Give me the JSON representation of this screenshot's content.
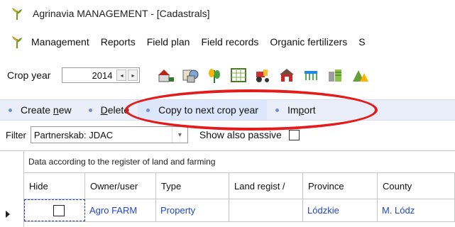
{
  "window": {
    "title": "Agrinavia MANAGEMENT - [Cadastrals]"
  },
  "menu": {
    "items": [
      "Management",
      "Reports",
      "Field plan",
      "Field records",
      "Organic fertilizers",
      "S"
    ]
  },
  "toolbar": {
    "crop_year_label": "Crop year",
    "crop_year_value": "2014",
    "spin_down": "◂",
    "spin_up": "▸"
  },
  "actions": {
    "create_new_first": "Create ",
    "create_new_underlined": "n",
    "create_new_rest": "ew",
    "delete_underlined": "D",
    "delete_rest": "elete",
    "copy_next": "Copy to next crop year",
    "import_first": "Im",
    "import_underlined": "p",
    "import_rest": "ort"
  },
  "filter": {
    "label": "Filter",
    "value": "Partnerskab: JDAC",
    "show_passive_label": "Show also passive"
  },
  "grid": {
    "caption": "Data according to the register of land and farming",
    "columns": [
      "Hide",
      "Owner/user",
      "Type",
      "Land regist /",
      "Province",
      "County"
    ],
    "rows": [
      {
        "hide": "",
        "owner": "Agro FARM",
        "type": "Property",
        "land_register": "",
        "province": "Lódzkie",
        "county": "M. Lódz"
      }
    ]
  },
  "annotation": {
    "oval_color": "#e41b1b"
  }
}
